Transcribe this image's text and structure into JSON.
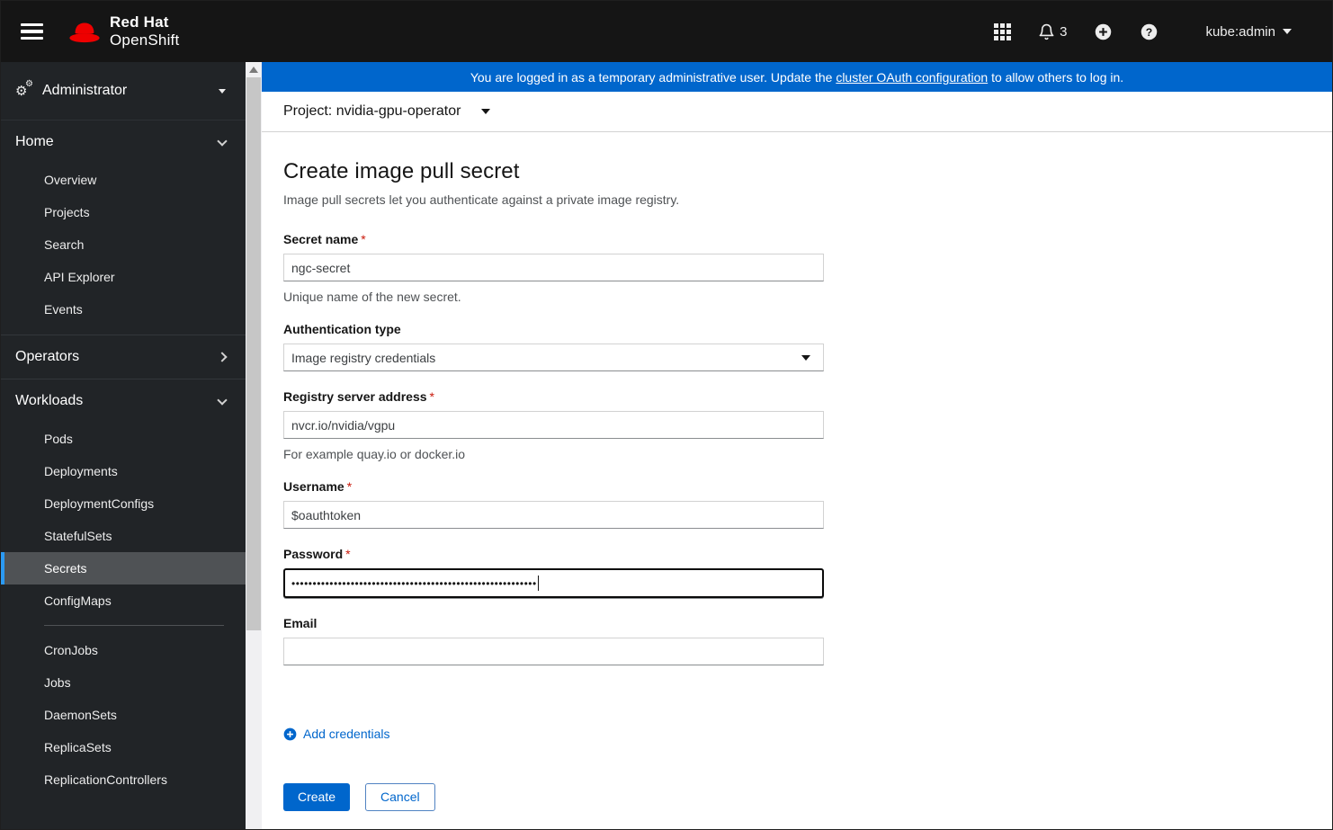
{
  "header": {
    "brand_line1": "Red Hat",
    "brand_line2": "OpenShift",
    "notification_count": "3",
    "username": "kube:admin"
  },
  "banner": {
    "text_before": "You are logged in as a temporary administrative user. Update the ",
    "link_text": "cluster OAuth configuration",
    "text_after": " to allow others to log in."
  },
  "project_bar": {
    "label": "Project: nvidia-gpu-operator"
  },
  "sidebar": {
    "perspective": "Administrator",
    "groups": [
      {
        "label": "Home",
        "items": [
          "Overview",
          "Projects",
          "Search",
          "API Explorer",
          "Events"
        ]
      },
      {
        "label": "Operators",
        "items": []
      },
      {
        "label": "Workloads",
        "items": [
          "Pods",
          "Deployments",
          "DeploymentConfigs",
          "StatefulSets",
          "Secrets",
          "ConfigMaps",
          "CronJobs",
          "Jobs",
          "DaemonSets",
          "ReplicaSets",
          "ReplicationControllers"
        ]
      }
    ],
    "selected_item": "Secrets"
  },
  "form": {
    "title": "Create image pull secret",
    "subtitle": "Image pull secrets let you authenticate against a private image registry.",
    "required_mark": "*",
    "secret_name": {
      "label": "Secret name",
      "value": "ngc-secret",
      "help": "Unique name of the new secret."
    },
    "auth_type": {
      "label": "Authentication type",
      "value": "Image registry credentials"
    },
    "registry": {
      "label": "Registry server address",
      "value": "nvcr.io/nvidia/vgpu",
      "help": "For example quay.io or docker.io"
    },
    "username": {
      "label": "Username",
      "value": "$oauthtoken"
    },
    "password": {
      "label": "Password",
      "masked_value": "••••••••••••••••••••••••••••••••••••••••••••••••••••••••••"
    },
    "email": {
      "label": "Email",
      "value": ""
    },
    "add_credentials_label": "Add credentials",
    "actions": {
      "create": "Create",
      "cancel": "Cancel"
    }
  },
  "colors": {
    "primary_blue": "#0066cc",
    "banner_blue": "#0066cc",
    "brand_red": "#ee0000",
    "selected_indicator_blue": "#2b9af3",
    "required_red": "#c9190b",
    "masthead_black": "#151515",
    "sidebar_dark": "#212427"
  }
}
